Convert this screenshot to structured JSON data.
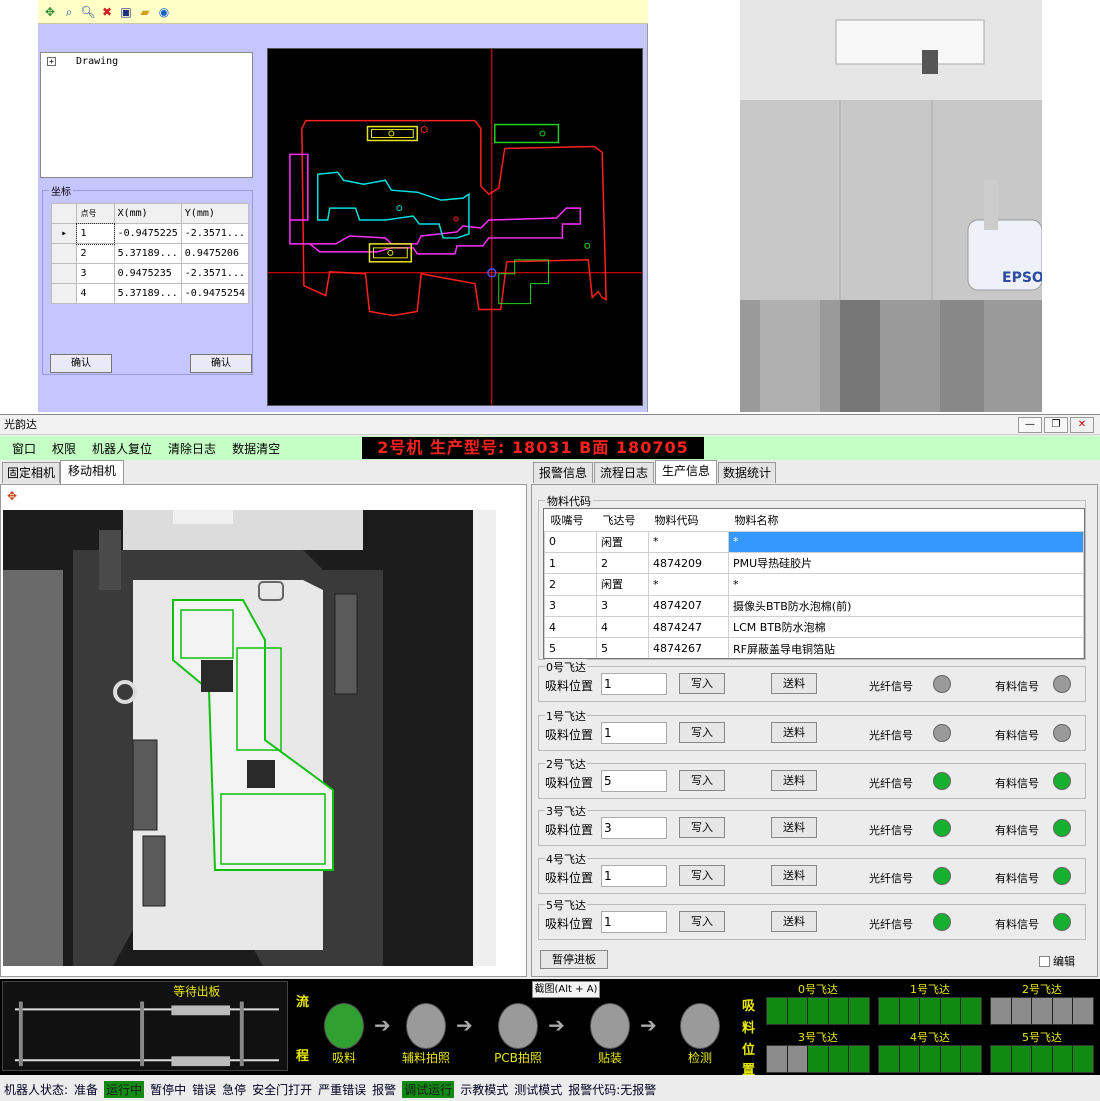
{
  "cad": {
    "tree_root": "Drawing",
    "coord_legend": "坐标",
    "coord_headers": [
      "点号",
      "X(mm)",
      "Y(mm)"
    ],
    "coord_rows": [
      {
        "id": "1",
        "x": "-0.9475225",
        "y": "-2.3571..."
      },
      {
        "id": "2",
        "x": "5.37189...",
        "y": "0.9475206"
      },
      {
        "id": "3",
        "x": "0.9475235",
        "y": "-2.3571..."
      },
      {
        "id": "4",
        "x": "5.37189...",
        "y": "-0.9475254"
      }
    ],
    "confirm_left": "确认",
    "confirm_right": "确认"
  },
  "photo": {
    "brand": "EPSO"
  },
  "window": {
    "title": "光韵达",
    "min": "—",
    "max": "❐",
    "close": "✕"
  },
  "menu": [
    "窗口",
    "权限",
    "机器人复位",
    "清除日志",
    "数据清空"
  ],
  "production_title": "2号机 生产型号:  18031 B面 180705",
  "cam_tabs": [
    "固定相机",
    "移动相机"
  ],
  "info_tabs": [
    "报警信息",
    "流程日志",
    "生产信息",
    "数据统计"
  ],
  "material": {
    "legend": "物料代码",
    "headers": [
      "吸嘴号",
      "飞达号",
      "物料代码",
      "物料名称"
    ],
    "rows": [
      [
        "0",
        "闲置",
        "*",
        "*"
      ],
      [
        "1",
        "2",
        "4874209",
        "PMU导热硅胶片"
      ],
      [
        "2",
        "闲置",
        "*",
        "*"
      ],
      [
        "3",
        "3",
        "4874207",
        "摄像头BTB防水泡棉(前)"
      ],
      [
        "4",
        "4",
        "4874247",
        "LCM BTB防水泡棉"
      ],
      [
        "5",
        "5",
        "4874267",
        "RF屏蔽盖导电铜箔贴"
      ]
    ]
  },
  "feeders": [
    {
      "name": "0号飞达",
      "pos_label": "吸料位置",
      "value": "1",
      "write": "写入",
      "send": "送料",
      "fiber": "光纤信号",
      "material": "有料信号",
      "fiber_on": false,
      "material_on": false
    },
    {
      "name": "1号飞达",
      "pos_label": "吸料位置",
      "value": "1",
      "write": "写入",
      "send": "送料",
      "fiber": "光纤信号",
      "material": "有料信号",
      "fiber_on": false,
      "material_on": false
    },
    {
      "name": "2号飞达",
      "pos_label": "吸料位置",
      "value": "5",
      "write": "写入",
      "send": "送料",
      "fiber": "光纤信号",
      "material": "有料信号",
      "fiber_on": true,
      "material_on": true
    },
    {
      "name": "3号飞达",
      "pos_label": "吸料位置",
      "value": "3",
      "write": "写入",
      "send": "送料",
      "fiber": "光纤信号",
      "material": "有料信号",
      "fiber_on": true,
      "material_on": true
    },
    {
      "name": "4号飞达",
      "pos_label": "吸料位置",
      "value": "1",
      "write": "写入",
      "send": "送料",
      "fiber": "光纤信号",
      "material": "有料信号",
      "fiber_on": true,
      "material_on": true
    },
    {
      "name": "5号飞达",
      "pos_label": "吸料位置",
      "value": "1",
      "write": "写入",
      "send": "送料",
      "fiber": "光纤信号",
      "material": "有料信号",
      "fiber_on": true,
      "material_on": true
    }
  ],
  "pause_button": "暂停进板",
  "edit_label": "编辑",
  "conveyor_label": "等待出板",
  "flow": {
    "side_label": [
      "流",
      "程"
    ],
    "steps": [
      "吸料",
      "辅料拍照",
      "PCB拍照",
      "贴装",
      "检测"
    ],
    "active_step": 0
  },
  "suction_label": [
    "吸",
    "料",
    "位",
    "置"
  ],
  "feeder_positions": [
    {
      "name": "0号飞达",
      "cells": [
        "g",
        "g",
        "g",
        "g",
        "g"
      ]
    },
    {
      "name": "1号飞达",
      "cells": [
        "g",
        "g",
        "g",
        "g",
        "g"
      ]
    },
    {
      "name": "2号飞达",
      "cells": [
        "gr",
        "gr",
        "gr",
        "gr",
        "gr"
      ]
    },
    {
      "name": "3号飞达",
      "cells": [
        "gr",
        "gr",
        "g",
        "g",
        "g"
      ]
    },
    {
      "name": "4号飞达",
      "cells": [
        "g",
        "g",
        "g",
        "g",
        "g"
      ]
    },
    {
      "name": "5号飞达",
      "cells": [
        "g",
        "g",
        "g",
        "g",
        "g"
      ]
    }
  ],
  "tooltip": "截图(Alt + A)",
  "status": {
    "prefix": "机器人状态:",
    "items": [
      "准备",
      "运行中",
      "暂停中",
      "错误",
      "急停",
      "安全门打开",
      "严重错误",
      "报警",
      "调试运行",
      "示教模式",
      "测试模式",
      "报警代码:无报警"
    ],
    "highlighted": [
      1,
      8
    ]
  },
  "colors": {
    "menu_bg": "#c6ffc6",
    "led_on": "#16b030",
    "led_off": "#9a9a9a",
    "title_red": "#ff2020",
    "flow_yellow": "#e8e800"
  }
}
